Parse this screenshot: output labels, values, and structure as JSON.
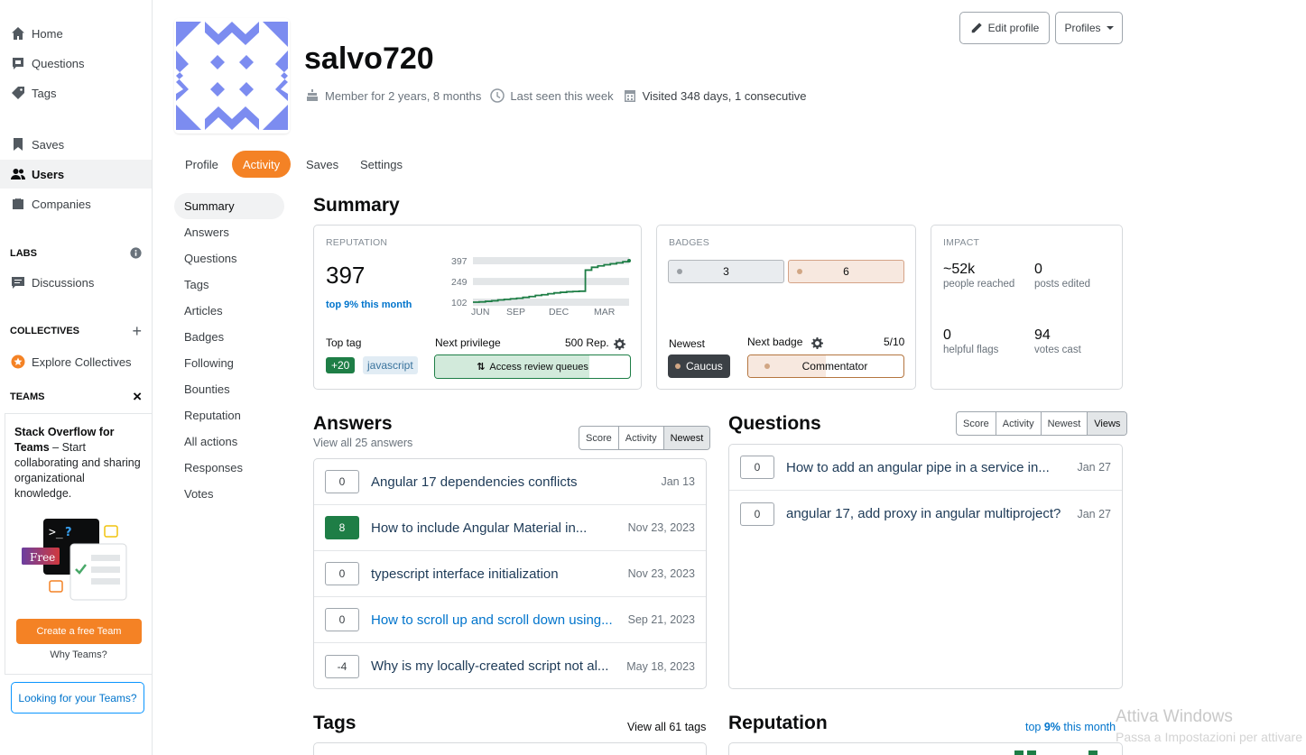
{
  "sidebar": {
    "items": [
      {
        "label": "Home",
        "icon": "home-icon"
      },
      {
        "label": "Questions",
        "icon": "questions-icon"
      },
      {
        "label": "Tags",
        "icon": "tag-icon"
      },
      {
        "label": "Saves",
        "icon": "bookmark-icon"
      },
      {
        "label": "Users",
        "icon": "users-icon"
      },
      {
        "label": "Companies",
        "icon": "briefcase-icon"
      },
      {
        "label": "Discussions",
        "icon": "discussions-icon"
      },
      {
        "label": "Explore Collectives",
        "icon": "collectives-icon"
      }
    ],
    "labs": "LABS",
    "collectives": "COLLECTIVES",
    "teams": "TEAMS",
    "teams_promo": {
      "title": "Stack Overflow for Teams",
      "text": " – Start collaborating and sharing organizational knowledge.",
      "free": "Free",
      "cta": "Create a free Team",
      "why": "Why Teams?"
    },
    "looking": "Looking for your Teams?"
  },
  "profile": {
    "username": "salvo720",
    "member_for": "Member for 2 years, 8 months",
    "last_seen": "Last seen this week",
    "visited": "Visited 348 days, 1 consecutive",
    "edit_profile": "Edit profile",
    "profiles": "Profiles"
  },
  "tabs": [
    "Profile",
    "Activity",
    "Saves",
    "Settings"
  ],
  "subnav": [
    "Summary",
    "Answers",
    "Questions",
    "Tags",
    "Articles",
    "Badges",
    "Following",
    "Bounties",
    "Reputation",
    "All actions",
    "Responses",
    "Votes"
  ],
  "summary": {
    "title": "Summary",
    "reputation": {
      "label": "REPUTATION",
      "value": "397",
      "top": "top 9% this month",
      "top_tag_label": "Top tag",
      "top_tag_score": "+20",
      "top_tag": "javascript",
      "next_privilege_label": "Next privilege",
      "next_privilege_rep": "500 Rep.",
      "next_privilege": "Access review queues",
      "privilege_progress": 0.79
    },
    "badges": {
      "label": "BADGES",
      "silver": "3",
      "bronze": "6",
      "newest_label": "Newest",
      "newest": "Caucus",
      "next_label": "Next badge",
      "next_progress": "5/10",
      "next": "Commentator",
      "next_fraction": 0.5
    },
    "impact": {
      "label": "IMPACT",
      "stats": [
        {
          "value": "~52k",
          "label": "people reached"
        },
        {
          "value": "0",
          "label": "posts edited"
        },
        {
          "value": "0",
          "label": "helpful flags"
        },
        {
          "value": "94",
          "label": "votes cast"
        }
      ]
    }
  },
  "chart_data": {
    "type": "line",
    "x": [
      "JUN",
      "SEP",
      "DEC",
      "MAR"
    ],
    "yticks": [
      "397",
      "249",
      "102"
    ],
    "ylim": [
      102,
      397
    ],
    "series": [
      {
        "values": [
          102,
          104,
          108,
          112,
          118,
          122,
          126,
          130,
          136,
          142,
          150,
          155,
          162,
          168,
          172,
          176,
          178,
          180,
          330,
          350,
          360,
          368,
          375,
          382,
          390,
          397
        ]
      }
    ],
    "color": "#1e7e46"
  },
  "answers": {
    "title": "Answers",
    "subtitle": "View all 25 answers",
    "filters": [
      "Score",
      "Activity",
      "Newest"
    ],
    "selected": "Newest",
    "rows": [
      {
        "score": "0",
        "title": "Angular 17 dependencies conflicts",
        "date": "Jan 13",
        "accepted": false,
        "link": false
      },
      {
        "score": "8",
        "title": "How to include Angular Material in...",
        "date": "Nov 23, 2023",
        "accepted": true,
        "link": false
      },
      {
        "score": "0",
        "title": "typescript interface initialization",
        "date": "Nov 23, 2023",
        "accepted": false,
        "link": false
      },
      {
        "score": "0",
        "title": "How to scroll up and scroll down using...",
        "date": "Sep 21, 2023",
        "accepted": false,
        "link": true
      },
      {
        "score": "-4",
        "title": "Why is my locally-created script not al...",
        "date": "May 18, 2023",
        "accepted": false,
        "link": false
      }
    ]
  },
  "questions": {
    "title": "Questions",
    "filters": [
      "Score",
      "Activity",
      "Newest",
      "Views"
    ],
    "selected": "Views",
    "rows": [
      {
        "score": "0",
        "title": "How to add an angular pipe in a service in...",
        "date": "Jan 27"
      },
      {
        "score": "0",
        "title": "angular 17, add proxy in angular multiproject?",
        "date": "Jan 27"
      }
    ]
  },
  "tags": {
    "title": "Tags",
    "view_all": "View all 61 tags"
  },
  "reputation_section": {
    "title": "Reputation",
    "top_prefix": "top ",
    "top_pct": "9%",
    "top_suffix": " this month"
  },
  "watermark": {
    "line1": "Attiva Windows",
    "line2": "Passa a Impostazioni per attivare"
  }
}
